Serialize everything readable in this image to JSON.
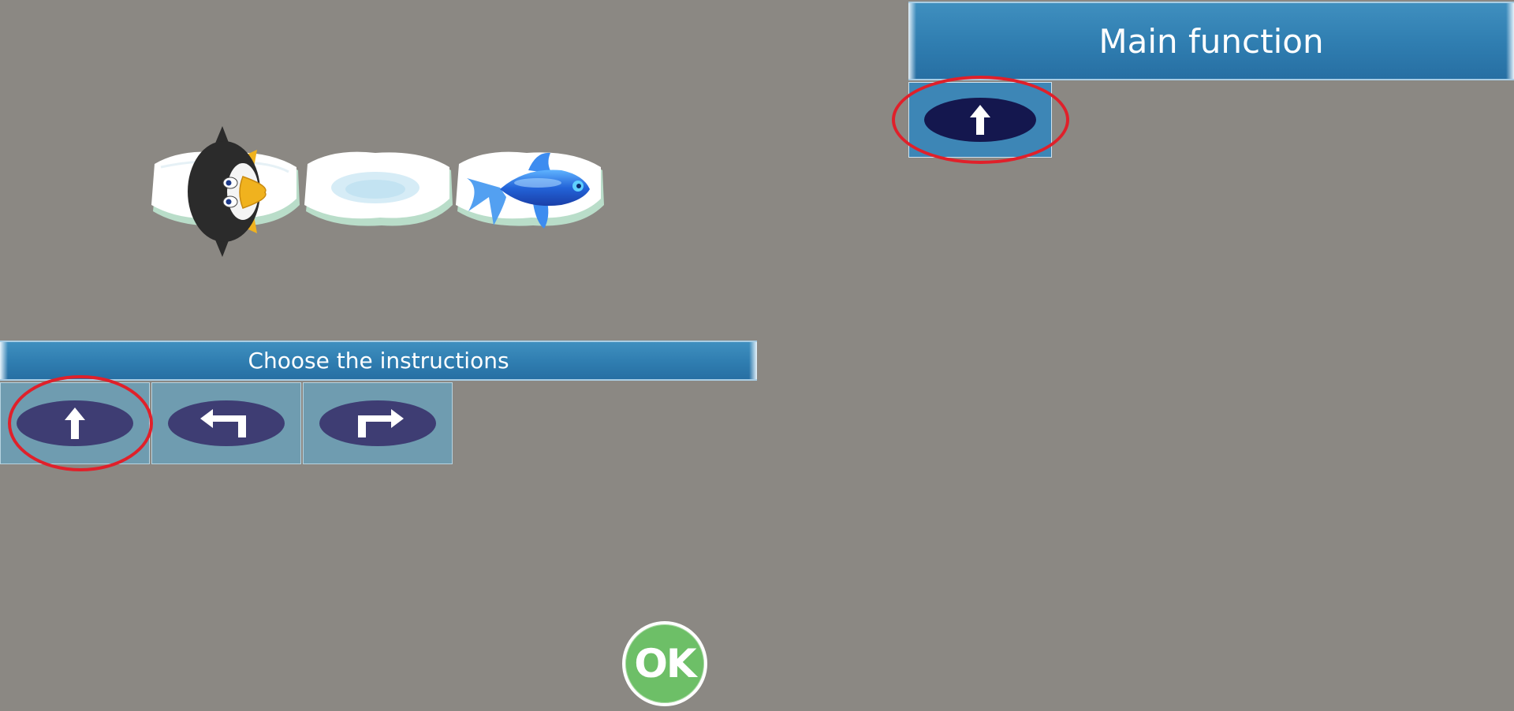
{
  "main_function": {
    "title": "Main function",
    "instructions": [
      "forward"
    ]
  },
  "instruction_palette": {
    "title": "Choose the instructions",
    "items": [
      {
        "name": "forward",
        "icon": "arrow-up-icon"
      },
      {
        "name": "turn-left",
        "icon": "arrow-turn-left-icon"
      },
      {
        "name": "turn-right",
        "icon": "arrow-turn-right-icon"
      }
    ],
    "selected": "forward"
  },
  "board": {
    "tiles": [
      "ice-floe",
      "ice-floe",
      "ice-floe"
    ],
    "player": "penguin",
    "goal": "fish",
    "player_facing": "right"
  },
  "ok_button": {
    "label": "OK"
  },
  "colors": {
    "background": "#8b8883",
    "banner": "#2f7db0",
    "palette_tile": "#6f9cb0",
    "instruction_oval": "#3e3d73",
    "program_oval": "#14174e",
    "highlight": "#e0202a",
    "ok_green": "#6dbf67"
  }
}
